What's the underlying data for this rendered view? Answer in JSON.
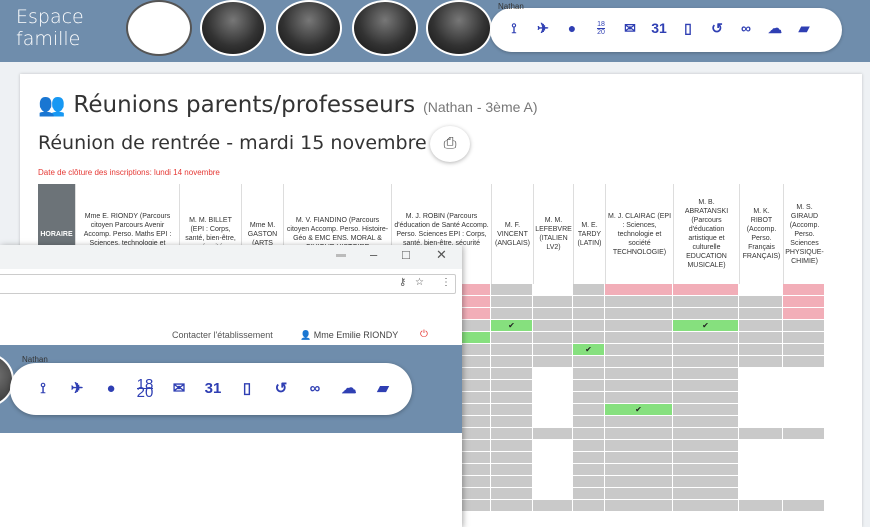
{
  "header": {
    "brand_line1": "Espace",
    "brand_line2": "famille",
    "student_name": "Nathan"
  },
  "nav_icons": [
    {
      "name": "skills-icon",
      "glyph": "⟟"
    },
    {
      "name": "pin-icon",
      "glyph": "✈"
    },
    {
      "name": "chat-icon",
      "glyph": "●"
    },
    {
      "name": "grades-icon",
      "top": "18",
      "bottom": "20"
    },
    {
      "name": "mail-icon",
      "glyph": "✉"
    },
    {
      "name": "calendar-icon",
      "glyph": "31"
    },
    {
      "name": "notebook-icon",
      "glyph": "▯"
    },
    {
      "name": "history-icon",
      "glyph": "↺"
    },
    {
      "name": "link-icon",
      "glyph": "∞"
    },
    {
      "name": "cloud-icon",
      "glyph": "☁"
    },
    {
      "name": "book-icon",
      "glyph": "▰"
    }
  ],
  "page": {
    "title": "Réunions parents/professeurs",
    "subtitle": "(Nathan - 3ème A)",
    "meeting": "Réunion de rentrée - mardi 15 novembre",
    "deadline": "Date de clôture des inscriptions: lundi 14 novembre",
    "horaire": "HORAIRE"
  },
  "columns": [
    {
      "label": "Mme E. RIONDY (Parcours citoyen Parcours Avenir Accomp. Perso. Maths EPI : Sciences, technologie et société"
    },
    {
      "label": "M. M. BILLET (EPI : Corps, santé, bien-être, sécurité"
    },
    {
      "label": "Mme M. GASTON (ARTS"
    },
    {
      "label": "M. V. FIANDINO (Parcours citoyen Accomp. Perso. Histoire-Géo & EMC ENS. MORAL & CIVIQUE HISTOIRE"
    },
    {
      "label": "M. J. ROBIN (Parcours d'éducation de Santé Accomp. Perso. Sciences EPI : Corps, santé, bien-être, sécurité S.V.T.)"
    },
    {
      "label": "M. F. VINCENT (ANGLAIS)"
    },
    {
      "label": "M. M. LEFEBVRE (ITALIEN LV2)"
    },
    {
      "label": "M. E. TARDY (LATIN)"
    },
    {
      "label": "M. J. CLAIRAC (EPI : Sciences, technologie et société TECHNOLOGIE)"
    },
    {
      "label": "M. B. ABRATANSKI (Parcours d'éducation artistique et culturelle EDUCATION MUSICALE)"
    },
    {
      "label": "M. K. RIBOT (Accomp. Perso. Français FRANÇAIS)"
    },
    {
      "label": "M. S. GIRAUD (Accomp. Perso. Sciences PHYSIQUE-CHIMIE)"
    }
  ],
  "booked_mark": "✔",
  "front": {
    "contact": "Contacter l'établissement",
    "user": "Mme Emilie RIONDY"
  },
  "colors": {
    "header_blue": "#6f8dac",
    "slot_grey": "#c9c9c9",
    "slot_red": "#f2aeb8",
    "slot_white": "#ffffff",
    "slot_green": "#86e07e",
    "alert_red": "#e53935"
  }
}
